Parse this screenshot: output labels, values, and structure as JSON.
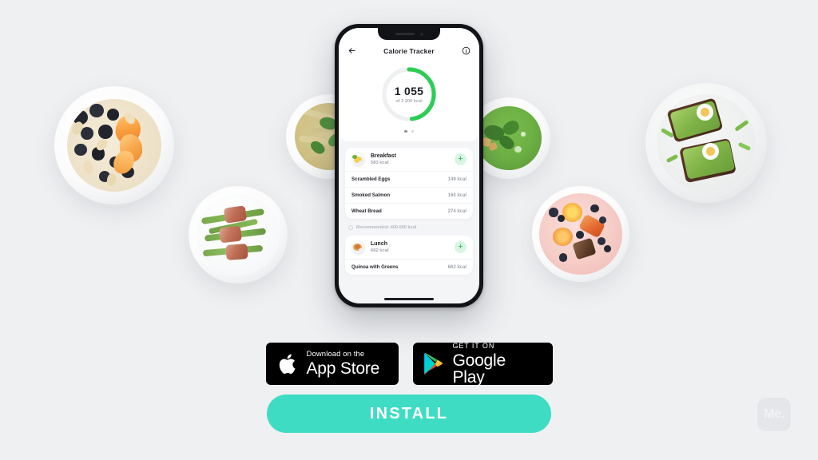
{
  "page": {
    "background_color": "#eff0f2",
    "accent_color": "#3fdcc4",
    "ring_color": "#2ecc55"
  },
  "phone": {
    "app": {
      "back_icon": "arrow-left-icon",
      "title": "Calorie Tracker",
      "info_icon": "info-circle-icon",
      "ring": {
        "value": "1 055",
        "goal_label": "of 2 200 kcal",
        "consumed_kcal": 1055,
        "goal_kcal": 2200,
        "percent": 48
      },
      "pager": {
        "total": 2,
        "active": 1
      },
      "meals": [
        {
          "name": "Breakfast",
          "kcal_label": "583 kcal",
          "thumb_icon": "scrambled-eggs-thumb",
          "add_icon": "plus-icon",
          "items": [
            {
              "name": "Scrambled Eggs",
              "kcal": "149 kcal"
            },
            {
              "name": "Smoked Salmon",
              "kcal": "160 kcal"
            },
            {
              "name": "Wheat Bread",
              "kcal": "274 kcal"
            }
          ],
          "recommendation": "Recommended: 400-500 kcal"
        },
        {
          "name": "Lunch",
          "kcal_label": "662 kcal",
          "thumb_icon": "pasta-bowl-thumb",
          "add_icon": "plus-icon",
          "items": [
            {
              "name": "Quinoa with Greens",
              "kcal": "662 kcal"
            }
          ]
        }
      ]
    }
  },
  "store_badges": [
    {
      "id": "app-store",
      "small_text": "Download on the",
      "big_text": "App Store",
      "icon": "apple-logo-icon"
    },
    {
      "id": "google-play",
      "small_text": "GET IT ON",
      "big_text": "Google Play",
      "icon": "google-play-logo-icon"
    }
  ],
  "install_button": {
    "label": "INSTALL"
  },
  "watermark": {
    "label": "Me."
  },
  "food_photos": [
    {
      "id": "oatmeal-bowl",
      "description": "Oatmeal with blueberries, peach slices and almonds"
    },
    {
      "id": "bacon-asparagus",
      "description": "Bacon-wrapped asparagus on white plate"
    },
    {
      "id": "pesto-pasta",
      "description": "Pesto spaghetti with basil leaves"
    },
    {
      "id": "green-soup",
      "description": "Green spinach soup with croutons"
    },
    {
      "id": "smoothie-bowl",
      "description": "Pink smoothie bowl with berries and fruit"
    },
    {
      "id": "avocado-toast",
      "description": "Avocado toast with boiled egg on speckled plate"
    }
  ]
}
